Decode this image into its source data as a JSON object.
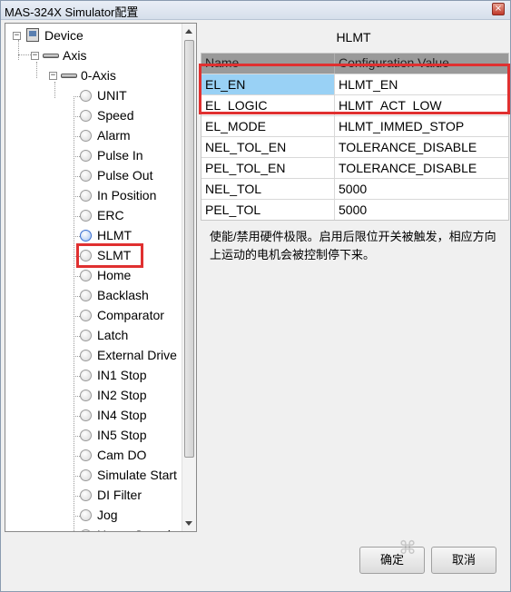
{
  "window": {
    "title": "MAS-324X Simulator配置",
    "close_glyph": "×"
  },
  "tree": {
    "device": "Device",
    "axis": "Axis",
    "axis0": "0-Axis",
    "leaves": [
      "UNIT",
      "Speed",
      "Alarm",
      "Pulse In",
      "Pulse Out",
      "In Position",
      "ERC",
      "HLMT",
      "SLMT",
      "Home",
      "Backlash",
      "Comparator",
      "Latch",
      "External Drive",
      "IN1 Stop",
      "IN2 Stop",
      "IN4 Stop",
      "IN5 Stop",
      "Cam DO",
      "Simulate Start",
      "DI Filter",
      "Jog",
      "Home Search"
    ],
    "selected": "HLMT"
  },
  "panel": {
    "title": "HLMT",
    "columns": [
      "Name",
      "Configuration Value"
    ],
    "rows": [
      {
        "name": "EL_EN",
        "value": "HLMT_EN"
      },
      {
        "name": "EL_LOGIC",
        "value": "HLMT_ACT_LOW"
      },
      {
        "name": "EL_MODE",
        "value": "HLMT_IMMED_STOP"
      },
      {
        "name": "NEL_TOL_EN",
        "value": "TOLERANCE_DISABLE"
      },
      {
        "name": "PEL_TOL_EN",
        "value": "TOLERANCE_DISABLE"
      },
      {
        "name": "NEL_TOL",
        "value": "5000"
      },
      {
        "name": "PEL_TOL",
        "value": "5000"
      }
    ],
    "description": "使能/禁用硬件极限。启用后限位开关被触发，相应方向上运动的电机会被控制停下来。"
  },
  "buttons": {
    "ok": "确定",
    "cancel": "取消"
  },
  "colors": {
    "highlight_box": "#e03030",
    "selected_cell": "#99d1f5",
    "grid_header": "#9a9a9a"
  }
}
